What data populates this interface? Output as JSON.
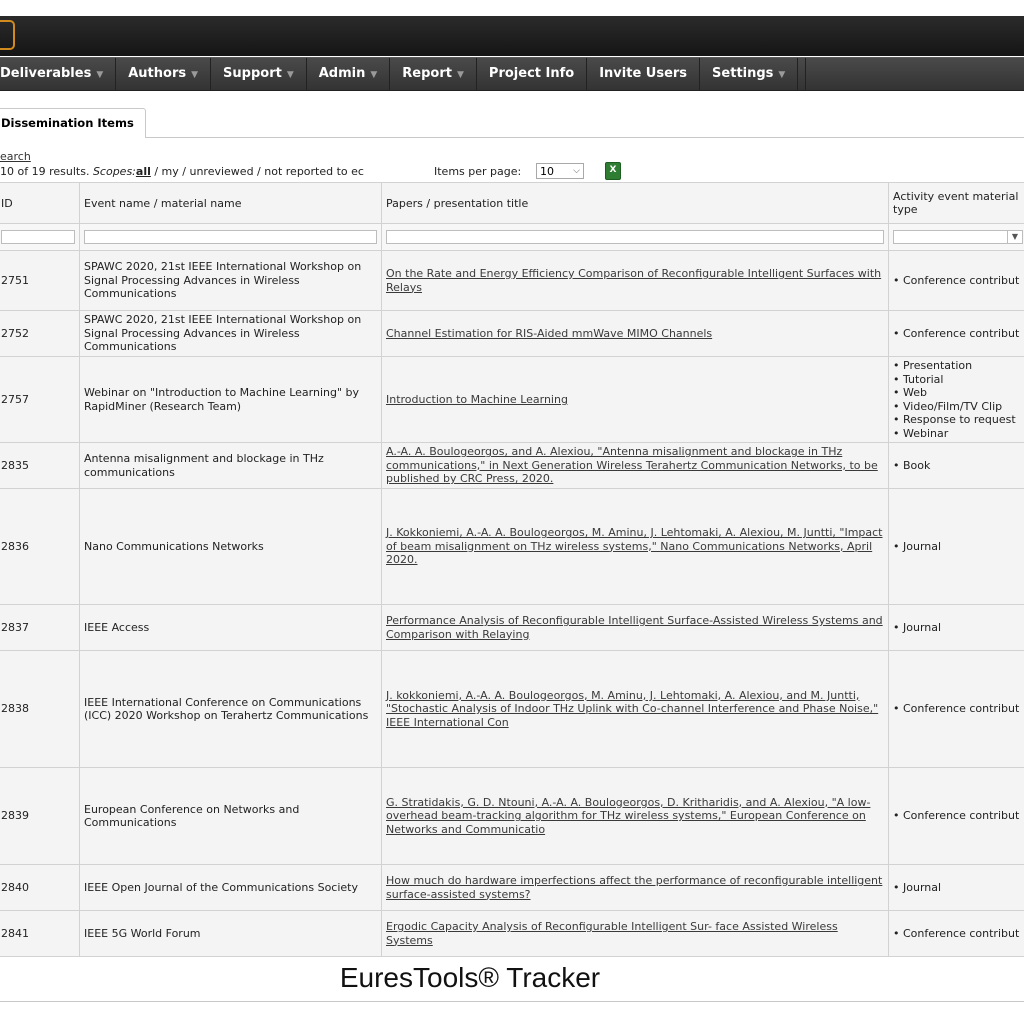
{
  "menu": [
    {
      "label": "Deliverables",
      "has_caret": true
    },
    {
      "label": "Authors",
      "has_caret": true
    },
    {
      "label": "Support",
      "has_caret": true
    },
    {
      "label": "Admin",
      "has_caret": true
    },
    {
      "label": "Report",
      "has_caret": true
    },
    {
      "label": "Project Info",
      "has_caret": false
    },
    {
      "label": "Invite Users",
      "has_caret": false
    },
    {
      "label": "Settings",
      "has_caret": true
    }
  ],
  "caret_glyph": "▼",
  "tab": {
    "label": "Dissemination Items"
  },
  "search_link": "earch",
  "results": {
    "prefix": "10 of 19 results. ",
    "scopes_label": "Scopes:",
    "scope_all": "all",
    "scope_rest": " / my / unreviewed / not reported to ec"
  },
  "items_per_page": {
    "label": "Items per page:",
    "value": "10"
  },
  "excel_icon": "excel-export-icon",
  "table": {
    "headers": [
      "ID",
      "Event name / material name",
      "Papers / presentation title",
      "Activity event material type"
    ],
    "rows": [
      {
        "id": "2751",
        "event": "SPAWC 2020, 21st IEEE International Workshop on Signal Processing Advances in Wireless Communications",
        "paper": "On the Rate and Energy Efficiency Comparison of Reconfigurable Intelligent Surfaces with Relays",
        "types": [
          "Conference contribut"
        ]
      },
      {
        "id": "2752",
        "event": "SPAWC 2020, 21st IEEE International Workshop on Signal Processing Advances in Wireless Communications",
        "paper": "Channel Estimation for RIS-Aided mmWave MIMO Channels",
        "types": [
          "Conference contribut"
        ]
      },
      {
        "id": "2757",
        "event": "Webinar on \"Introduction to Machine Learning\" by RapidMiner (Research Team)",
        "paper": "Introduction to Machine Learning",
        "types": [
          "Presentation",
          "Tutorial",
          "Web",
          "Video/Film/TV Clip",
          "Response to request",
          "Webinar"
        ]
      },
      {
        "id": "2835",
        "event": "Antenna misalignment and blockage in THz communications",
        "paper": "A.-A. A. Boulogeorgos, and A. Alexiou, \"Antenna misalignment and blockage in THz communications,\" in Next Generation Wireless Terahertz Communication Networks, to be published by CRC Press, 2020.",
        "types": [
          "Book"
        ]
      },
      {
        "id": "2836",
        "event": "Nano Communications Networks",
        "paper": "J. Kokkoniemi, A.-A. A. Boulogeorgos, M. Aminu, J. Lehtomaki, A. Alexiou, M. Juntti, \"Impact of beam misalignment on THz wireless systems,\" Nano Communications Networks, April 2020.",
        "types": [
          "Journal"
        ]
      },
      {
        "id": "2837",
        "event": "IEEE Access",
        "paper": "Performance Analysis of Reconfigurable Intelligent Surface-Assisted Wireless Systems and Comparison with Relaying",
        "types": [
          "Journal"
        ]
      },
      {
        "id": "2838",
        "event": "IEEE International Conference on Communications (ICC) 2020 Workshop on Terahertz Communications",
        "paper": "J. kokkoniemi, A.-A. A. Boulogeorgos, M. Aminu, J. Lehtomaki, A. Alexiou, and M. Juntti, \"Stochastic Analysis of Indoor THz Uplink with Co-channel Interference and Phase Noise,\" IEEE International Con",
        "types": [
          "Conference contribut"
        ]
      },
      {
        "id": "2839",
        "event": "European Conference on Networks and Communications",
        "paper": "G. Stratidakis, G. D. Ntouni, A.-A. A. Boulogeorgos, D. Kritharidis, and A. Alexiou, \"A low-overhead beam-tracking algorithm for THz wireless systems,\" European Conference on Networks and Communicatio",
        "types": [
          "Conference contribut"
        ]
      },
      {
        "id": "2840",
        "event": "IEEE Open Journal of the Communications Society",
        "paper": "How much do hardware imperfections affect the performance of reconfigurable intelligent surface-assisted systems?",
        "types": [
          "Journal"
        ]
      },
      {
        "id": "2841",
        "event": "IEEE 5G World Forum",
        "paper": "Ergodic Capacity Analysis of Reconfigurable Intelligent Sur- face Assisted Wireless Systems",
        "types": [
          "Conference contribut"
        ]
      }
    ]
  },
  "caption": "EuresTools® Tracker"
}
